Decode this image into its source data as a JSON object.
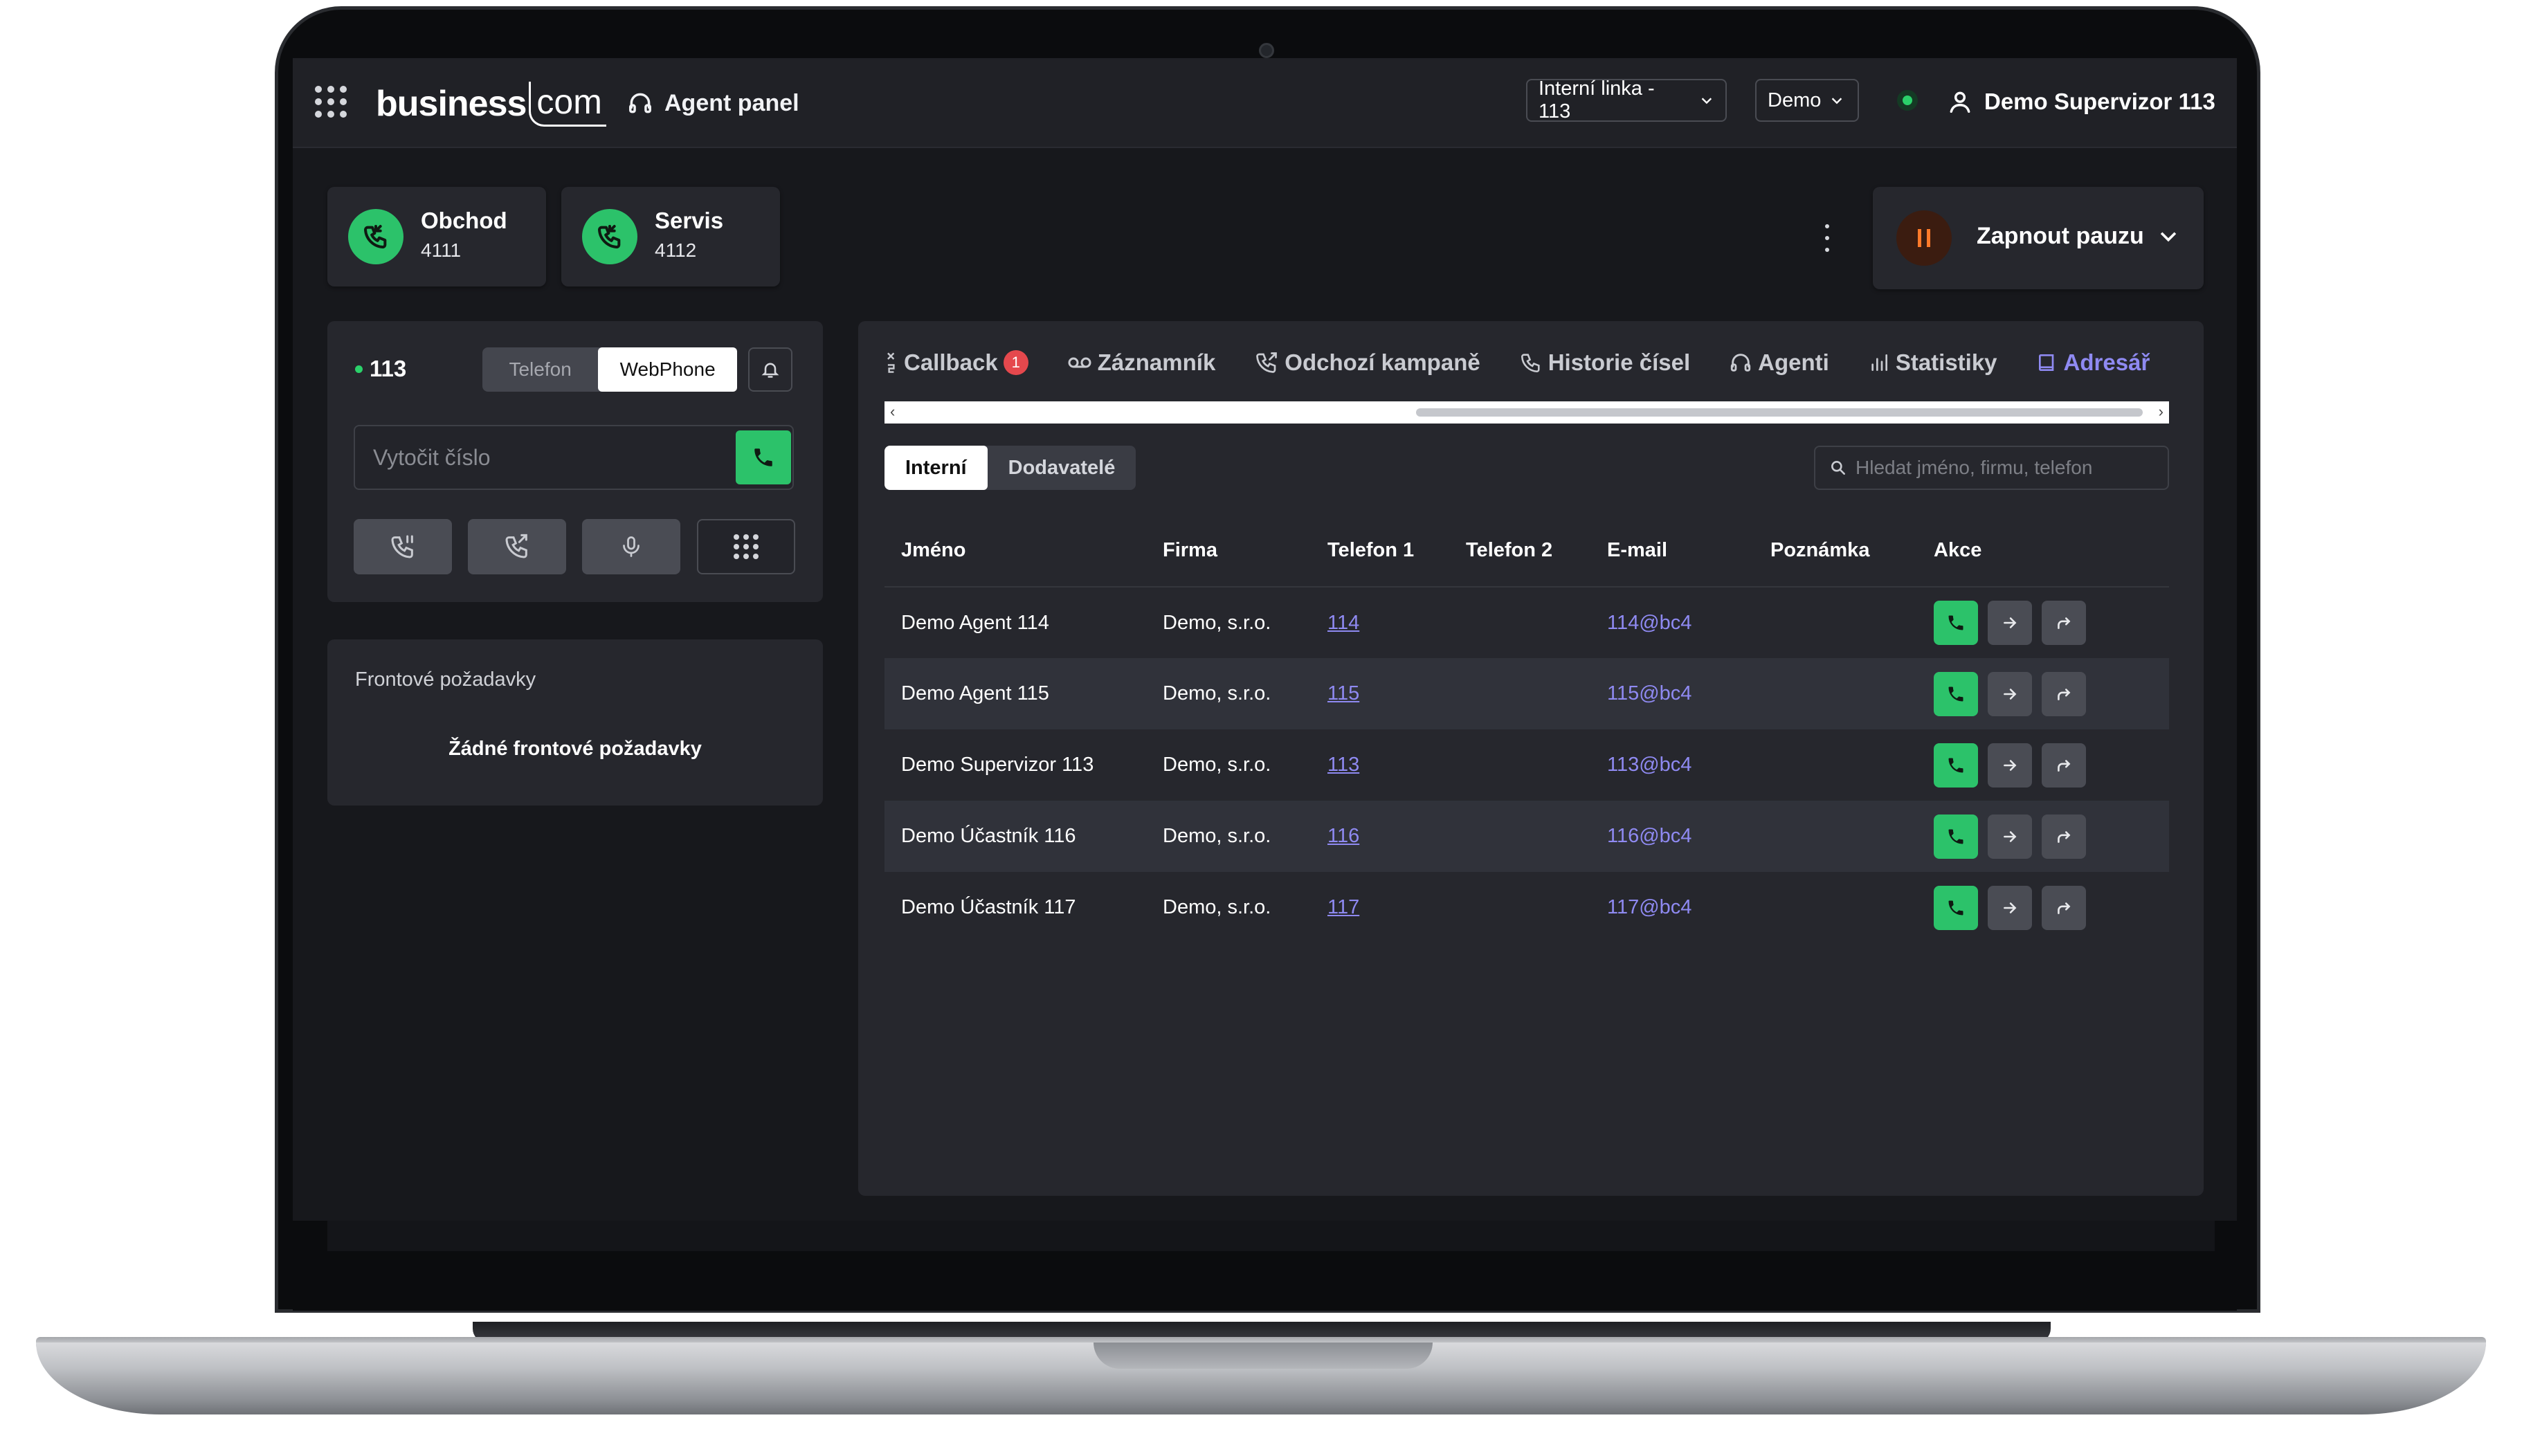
{
  "topbar": {
    "logo_main": "business",
    "logo_suffix": "com",
    "app_title": "Agent panel",
    "line_select": "Interní linka - 113",
    "env_select": "Demo",
    "user_name": "Demo Supervizor 113"
  },
  "queues": [
    {
      "name": "Obchod",
      "number": "4111"
    },
    {
      "name": "Servis",
      "number": "4112"
    }
  ],
  "pause": {
    "label": "Zapnout pauzu"
  },
  "phone": {
    "extension": "113",
    "mode_options": [
      "Telefon",
      "WebPhone"
    ],
    "mode_selected": "WebPhone",
    "dial_placeholder": "Vytočit číslo"
  },
  "queue_requests": {
    "title": "Frontové požadavky",
    "empty": "Žádné frontové požadavky"
  },
  "tabs": [
    {
      "label": "Callback",
      "badge": "1"
    },
    {
      "label": "Záznamník"
    },
    {
      "label": "Odchozí kampaně"
    },
    {
      "label": "Historie čísel"
    },
    {
      "label": "Agenti"
    },
    {
      "label": "Statistiky"
    },
    {
      "label": "Adresář",
      "active": true
    }
  ],
  "directory": {
    "subtabs": [
      "Interní",
      "Dodavatelé"
    ],
    "subtab_active": "Interní",
    "search_placeholder": "Hledat jméno, firmu, telefon",
    "columns": [
      "Jméno",
      "Firma",
      "Telefon 1",
      "Telefon 2",
      "E-mail",
      "Poznámka",
      "Akce"
    ],
    "rows": [
      {
        "name": "Demo Agent 114",
        "company": "Demo, s.r.o.",
        "phone1": "114",
        "phone2": "",
        "email": "114@bc4",
        "note": ""
      },
      {
        "name": "Demo Agent 115",
        "company": "Demo, s.r.o.",
        "phone1": "115",
        "phone2": "",
        "email": "115@bc4",
        "note": ""
      },
      {
        "name": "Demo Supervizor 113",
        "company": "Demo, s.r.o.",
        "phone1": "113",
        "phone2": "",
        "email": "113@bc4",
        "note": ""
      },
      {
        "name": "Demo Účastník 116",
        "company": "Demo, s.r.o.",
        "phone1": "116",
        "phone2": "",
        "email": "116@bc4",
        "note": ""
      },
      {
        "name": "Demo Účastník 117",
        "company": "Demo, s.r.o.",
        "phone1": "117",
        "phone2": "",
        "email": "117@bc4",
        "note": ""
      }
    ]
  },
  "colors": {
    "accent": "#8f8af2",
    "call_green": "#2cc26a",
    "status_online": "#2bd16a",
    "badge_red": "#e5484d",
    "pause_orange": "#ff7a2a"
  }
}
